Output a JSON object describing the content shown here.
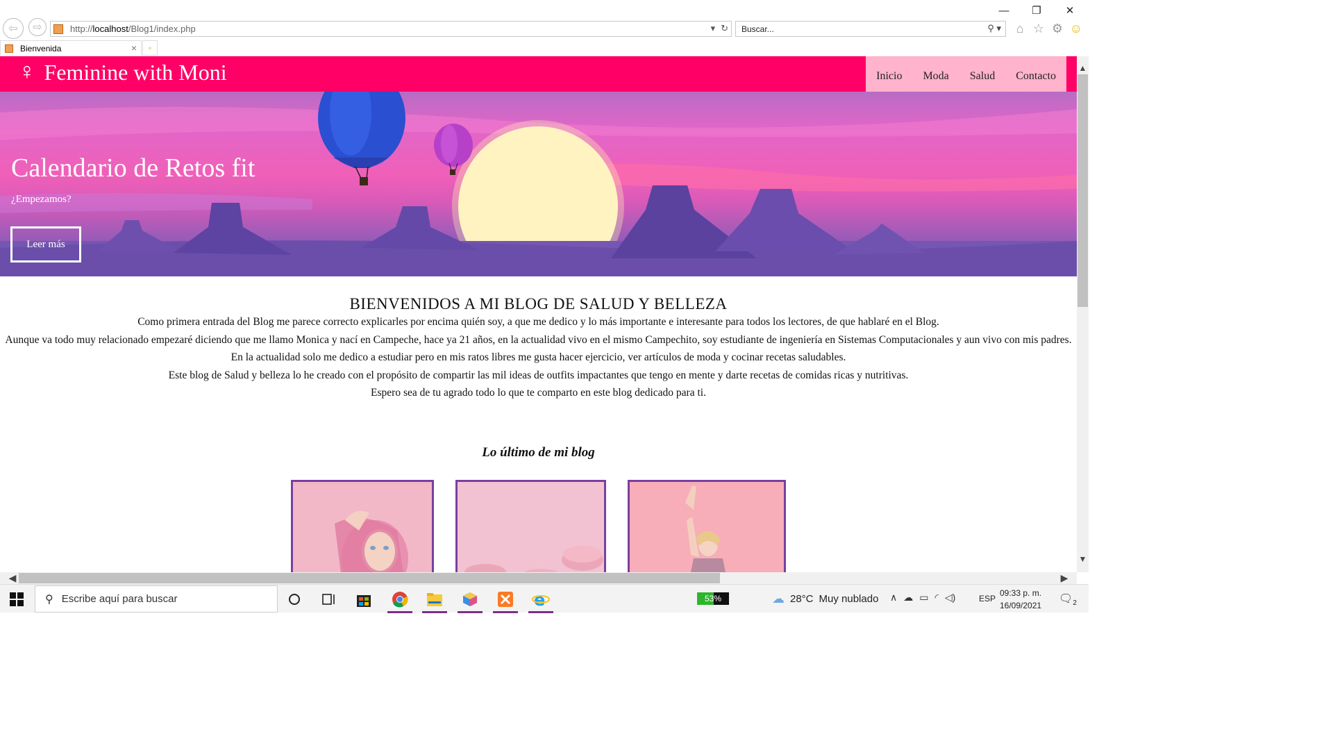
{
  "browser": {
    "url_prefix": "http://",
    "url_host": "localhost",
    "url_path": "/Blog1/index.php",
    "search_placeholder": "Buscar...",
    "tab_title": "Bienvenida",
    "controls": {
      "minimize": "—",
      "restore": "❐",
      "close": "✕"
    }
  },
  "site": {
    "title": "Feminine with Moni",
    "symbol": "♀",
    "nav": [
      "Inicio",
      "Moda",
      "Salud",
      "Contacto"
    ],
    "colors": {
      "header": "#ff0066",
      "nav": "#ffb3cc",
      "card_border": "#7a3fa0"
    }
  },
  "hero": {
    "title": "Calendario de Retos fit",
    "subtitle": "¿Empezamos?",
    "button": "Leer más"
  },
  "intro": {
    "heading": "BIENVENIDOS A MI BLOG DE SALUD Y BELLEZA",
    "paragraphs": [
      "Como primera entrada del Blog me parece correcto explicarles por encima quién soy, a que me dedico y lo más importante e interesante para todos los lectores, de que hablaré en el Blog.",
      "Aunque va todo muy relacionado empezaré diciendo que me llamo Monica y nací en Campeche, hace ya 21 años, en la actualidad vivo en el mismo Campechito, soy estudiante de ingeniería en Sistemas Computacionales y aun vivo con mis padres.",
      "En la actualidad solo me dedico a estudiar pero en mis ratos libres me gusta hacer ejercicio, ver artículos de moda y cocinar recetas saludables.",
      "Este blog de Salud y belleza lo he creado con el propósito de compartir las mil ideas de outfits impactantes que tengo en mente y darte recetas de comidas ricas y nutritivas.",
      "Espero sea de tu agrado todo lo que te comparto en este blog dedicado para ti."
    ]
  },
  "latest": {
    "heading": "Lo último de mi blog",
    "cards": [
      "pink-hair-portrait",
      "pink-macarons",
      "fitness-woman"
    ]
  },
  "taskbar": {
    "search_placeholder": "Escribe aquí para buscar",
    "battery": "53%",
    "battery_level": 0.53,
    "temperature": "28°C",
    "weather": "Muy nublado",
    "language": "ESP",
    "time": "09:33 p. m.",
    "date": "16/09/2021",
    "notifications": "2",
    "apps": [
      "chrome",
      "file-explorer",
      "vs-code-like-app",
      "xampp",
      "internet-explorer"
    ]
  }
}
